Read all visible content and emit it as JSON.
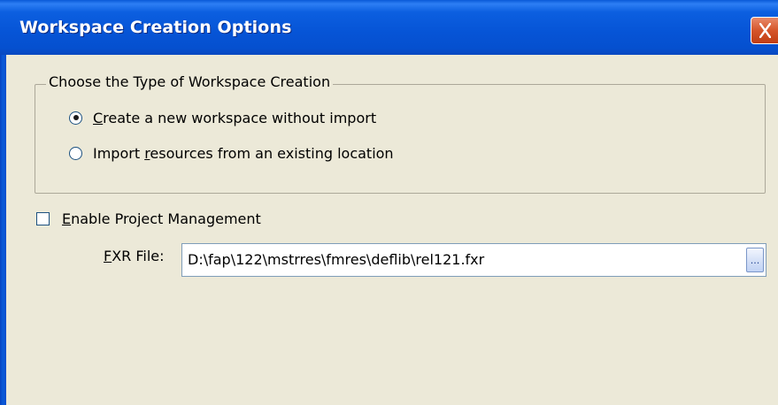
{
  "window": {
    "title": "Workspace Creation Options"
  },
  "creation_type": {
    "legend": "Choose the Type of Workspace Creation",
    "options": [
      {
        "prefix": "",
        "mnemonic": "C",
        "rest": "reate a new workspace without import",
        "selected": true
      },
      {
        "prefix": "Import ",
        "mnemonic": "r",
        "rest": "esources from an existing location",
        "selected": false
      }
    ]
  },
  "project_management": {
    "mnemonic": "E",
    "rest": "nable Project Management",
    "checked": false
  },
  "fxr_file": {
    "label_mnemonic": "F",
    "label_rest": "XR File:",
    "value": "D:\\fap\\122\\mstrres\\fmres\\deflib\\rel121.fxr",
    "browse_label": "..."
  },
  "icons": {
    "close": "close-icon"
  },
  "colors": {
    "titlebar": "#0654d6",
    "close": "#d5552a",
    "dialog_bg": "#ece9d8"
  }
}
